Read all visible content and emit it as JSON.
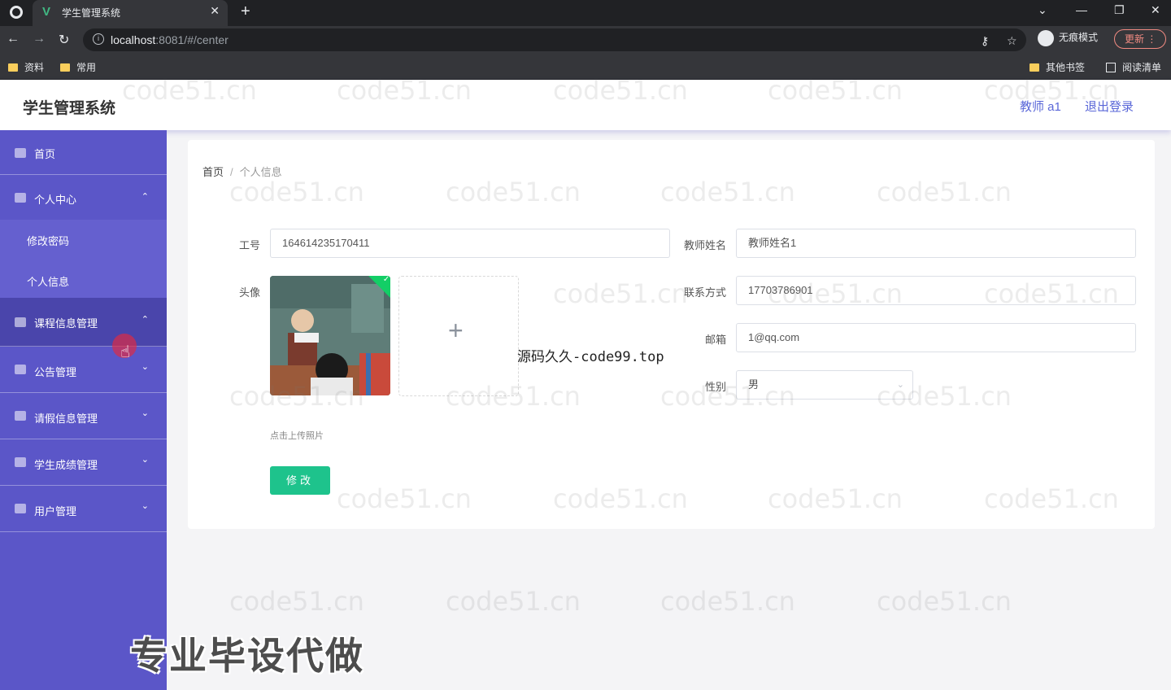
{
  "browser": {
    "tab_title": "学生管理系统",
    "url_host": "localhost",
    "url_rest": ":8081/#/center",
    "incognito_label": "无痕模式",
    "update_label": "更新",
    "bookmarks": [
      "资料",
      "常用"
    ],
    "bookmarks_right": [
      "其他书签",
      "阅读清单"
    ]
  },
  "header": {
    "app_title": "学生管理系统",
    "user_label": "教师 a1",
    "logout_label": "退出登录"
  },
  "sidebar": {
    "items": [
      {
        "label": "首页",
        "icon": "home-icon"
      },
      {
        "label": "个人中心",
        "icon": "user-icon",
        "expanded": true
      },
      {
        "label": "修改密码"
      },
      {
        "label": "个人信息"
      },
      {
        "label": "课程信息管理",
        "icon": "course-icon"
      },
      {
        "label": "公告管理",
        "icon": "notice-icon"
      },
      {
        "label": "请假信息管理",
        "icon": "leave-icon"
      },
      {
        "label": "学生成绩管理",
        "icon": "score-icon"
      },
      {
        "label": "用户管理",
        "icon": "users-icon"
      }
    ]
  },
  "breadcrumb": {
    "home": "首页",
    "separator": "/",
    "current": "个人信息"
  },
  "form": {
    "staff_no_label": "工号",
    "staff_no_value": "164614235170411",
    "teacher_name_label": "教师姓名",
    "teacher_name_value": "教师姓名1",
    "avatar_label": "头像",
    "phone_label": "联系方式",
    "phone_value": "17703786901",
    "email_label": "邮箱",
    "email_value": "1@qq.com",
    "gender_label": "性别",
    "gender_value": "男",
    "upload_tip": "点击上传照片",
    "submit_label": "修改"
  },
  "overlays": {
    "code_text": "源码久久-code99.top",
    "ad_text": "专业毕设代做",
    "watermark": "code51.cn"
  },
  "colors": {
    "sidebar": "#5b56c8",
    "accent": "#5a67d8",
    "submit": "#1ec38c"
  }
}
